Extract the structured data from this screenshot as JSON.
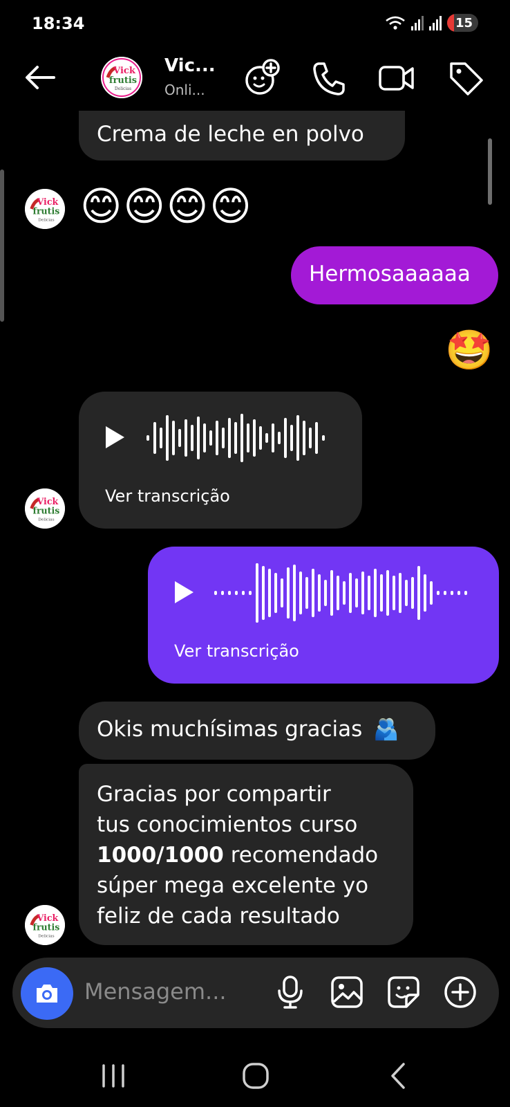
{
  "status_bar": {
    "time": "18:34",
    "battery": "15"
  },
  "header": {
    "name": "Vic...",
    "status": "Onli..."
  },
  "avatar_text": {
    "line1": "Vick",
    "line2": "frutis",
    "line3": "Delicias"
  },
  "messages": {
    "m1_text": "Crema de leche en polvo",
    "m2_emojis": "😊😊😊😊",
    "m3_text": "Hermosaaaaaa",
    "m4_reaction": "🤩",
    "m5_transcript": "Ver transcrição",
    "m6_transcript": "Ver transcrição",
    "m7_text": "Okis muchísimas gracias",
    "m7_emoji": "🫂",
    "m8_line1": "Gracias por compartir",
    "m8_line2": "tus conocimientos curso",
    "m8_bold": "1000/1000",
    "m8_line3_rest": " recomendado",
    "m8_line4": "súper mega excelente yo",
    "m8_line5": "feliz de cada resultado"
  },
  "composer": {
    "placeholder": "Mensagem..."
  },
  "colors": {
    "bubble_incoming": "#262626",
    "bubble_outgoing_pink": "#a31ad6",
    "bubble_outgoing_purple": "#7236f4",
    "camera_button": "#3b6af5"
  },
  "icons": {
    "header": [
      "back-arrow-icon",
      "add-person-icon",
      "phone-icon",
      "video-camera-icon",
      "tag-icon"
    ],
    "composer": [
      "camera-icon",
      "microphone-icon",
      "gallery-icon",
      "sticker-icon",
      "plus-circle-icon"
    ],
    "nav": [
      "recent-apps-icon",
      "home-icon",
      "back-icon"
    ]
  }
}
